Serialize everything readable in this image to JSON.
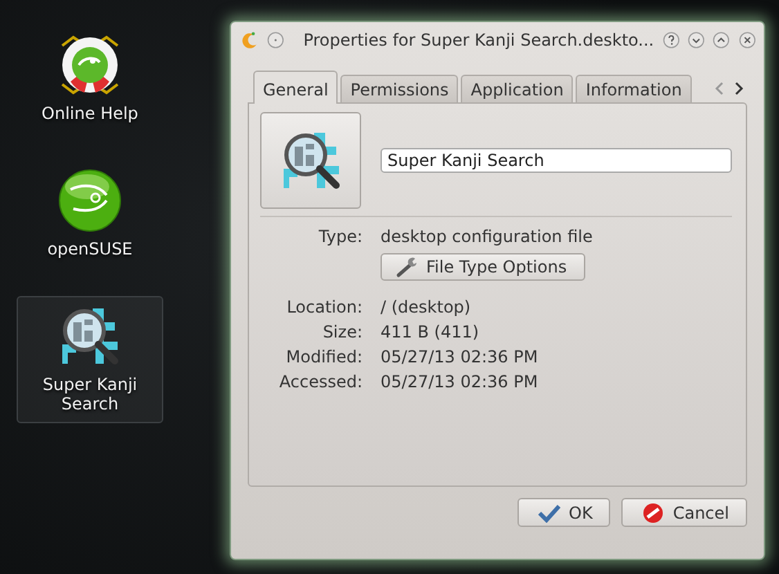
{
  "desktop_icons": [
    {
      "label": "Online Help",
      "kind": "help",
      "selected": false
    },
    {
      "label": "openSUSE",
      "kind": "suse",
      "selected": false
    },
    {
      "label": "Super Kanji Search",
      "kind": "kanji",
      "selected": true
    }
  ],
  "window": {
    "title": "Properties for Super Kanji Search.deskto...",
    "tabs": [
      {
        "label": "General",
        "selected": true
      },
      {
        "label": "Permissions",
        "selected": false
      },
      {
        "label": "Application",
        "selected": false
      },
      {
        "label": "Information",
        "selected": false
      }
    ],
    "name_field": {
      "value": "Super Kanji Search"
    },
    "properties": [
      {
        "label": "Type:",
        "value": "desktop configuration file"
      },
      {
        "label": "Location:",
        "value": "/ (desktop)"
      },
      {
        "label": "Size:",
        "value": "411 B (411)"
      },
      {
        "label": "Modified:",
        "value": "05/27/13 02:36 PM"
      },
      {
        "label": "Accessed:",
        "value": "05/27/13 02:36 PM"
      }
    ],
    "file_type_button": "File Type Options",
    "buttons": [
      {
        "label": "OK",
        "kind": "ok"
      },
      {
        "label": "Cancel",
        "kind": "cancel"
      }
    ]
  }
}
